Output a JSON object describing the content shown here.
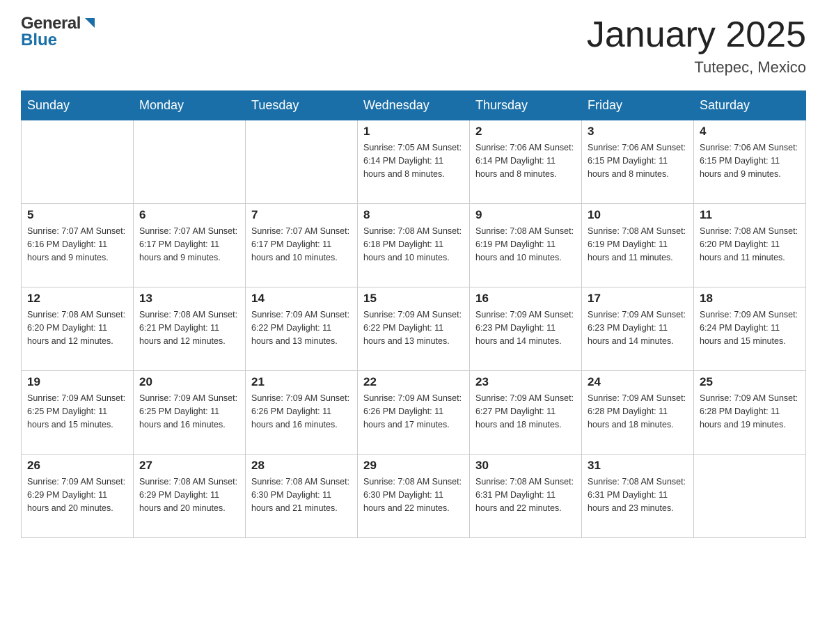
{
  "logo": {
    "text_general": "General",
    "text_blue": "Blue",
    "alt": "GeneralBlue logo"
  },
  "header": {
    "title": "January 2025",
    "subtitle": "Tutepec, Mexico"
  },
  "days_of_week": [
    "Sunday",
    "Monday",
    "Tuesday",
    "Wednesday",
    "Thursday",
    "Friday",
    "Saturday"
  ],
  "weeks": [
    [
      {
        "day": "",
        "info": ""
      },
      {
        "day": "",
        "info": ""
      },
      {
        "day": "",
        "info": ""
      },
      {
        "day": "1",
        "info": "Sunrise: 7:05 AM\nSunset: 6:14 PM\nDaylight: 11 hours and 8 minutes."
      },
      {
        "day": "2",
        "info": "Sunrise: 7:06 AM\nSunset: 6:14 PM\nDaylight: 11 hours and 8 minutes."
      },
      {
        "day": "3",
        "info": "Sunrise: 7:06 AM\nSunset: 6:15 PM\nDaylight: 11 hours and 8 minutes."
      },
      {
        "day": "4",
        "info": "Sunrise: 7:06 AM\nSunset: 6:15 PM\nDaylight: 11 hours and 9 minutes."
      }
    ],
    [
      {
        "day": "5",
        "info": "Sunrise: 7:07 AM\nSunset: 6:16 PM\nDaylight: 11 hours and 9 minutes."
      },
      {
        "day": "6",
        "info": "Sunrise: 7:07 AM\nSunset: 6:17 PM\nDaylight: 11 hours and 9 minutes."
      },
      {
        "day": "7",
        "info": "Sunrise: 7:07 AM\nSunset: 6:17 PM\nDaylight: 11 hours and 10 minutes."
      },
      {
        "day": "8",
        "info": "Sunrise: 7:08 AM\nSunset: 6:18 PM\nDaylight: 11 hours and 10 minutes."
      },
      {
        "day": "9",
        "info": "Sunrise: 7:08 AM\nSunset: 6:19 PM\nDaylight: 11 hours and 10 minutes."
      },
      {
        "day": "10",
        "info": "Sunrise: 7:08 AM\nSunset: 6:19 PM\nDaylight: 11 hours and 11 minutes."
      },
      {
        "day": "11",
        "info": "Sunrise: 7:08 AM\nSunset: 6:20 PM\nDaylight: 11 hours and 11 minutes."
      }
    ],
    [
      {
        "day": "12",
        "info": "Sunrise: 7:08 AM\nSunset: 6:20 PM\nDaylight: 11 hours and 12 minutes."
      },
      {
        "day": "13",
        "info": "Sunrise: 7:08 AM\nSunset: 6:21 PM\nDaylight: 11 hours and 12 minutes."
      },
      {
        "day": "14",
        "info": "Sunrise: 7:09 AM\nSunset: 6:22 PM\nDaylight: 11 hours and 13 minutes."
      },
      {
        "day": "15",
        "info": "Sunrise: 7:09 AM\nSunset: 6:22 PM\nDaylight: 11 hours and 13 minutes."
      },
      {
        "day": "16",
        "info": "Sunrise: 7:09 AM\nSunset: 6:23 PM\nDaylight: 11 hours and 14 minutes."
      },
      {
        "day": "17",
        "info": "Sunrise: 7:09 AM\nSunset: 6:23 PM\nDaylight: 11 hours and 14 minutes."
      },
      {
        "day": "18",
        "info": "Sunrise: 7:09 AM\nSunset: 6:24 PM\nDaylight: 11 hours and 15 minutes."
      }
    ],
    [
      {
        "day": "19",
        "info": "Sunrise: 7:09 AM\nSunset: 6:25 PM\nDaylight: 11 hours and 15 minutes."
      },
      {
        "day": "20",
        "info": "Sunrise: 7:09 AM\nSunset: 6:25 PM\nDaylight: 11 hours and 16 minutes."
      },
      {
        "day": "21",
        "info": "Sunrise: 7:09 AM\nSunset: 6:26 PM\nDaylight: 11 hours and 16 minutes."
      },
      {
        "day": "22",
        "info": "Sunrise: 7:09 AM\nSunset: 6:26 PM\nDaylight: 11 hours and 17 minutes."
      },
      {
        "day": "23",
        "info": "Sunrise: 7:09 AM\nSunset: 6:27 PM\nDaylight: 11 hours and 18 minutes."
      },
      {
        "day": "24",
        "info": "Sunrise: 7:09 AM\nSunset: 6:28 PM\nDaylight: 11 hours and 18 minutes."
      },
      {
        "day": "25",
        "info": "Sunrise: 7:09 AM\nSunset: 6:28 PM\nDaylight: 11 hours and 19 minutes."
      }
    ],
    [
      {
        "day": "26",
        "info": "Sunrise: 7:09 AM\nSunset: 6:29 PM\nDaylight: 11 hours and 20 minutes."
      },
      {
        "day": "27",
        "info": "Sunrise: 7:08 AM\nSunset: 6:29 PM\nDaylight: 11 hours and 20 minutes."
      },
      {
        "day": "28",
        "info": "Sunrise: 7:08 AM\nSunset: 6:30 PM\nDaylight: 11 hours and 21 minutes."
      },
      {
        "day": "29",
        "info": "Sunrise: 7:08 AM\nSunset: 6:30 PM\nDaylight: 11 hours and 22 minutes."
      },
      {
        "day": "30",
        "info": "Sunrise: 7:08 AM\nSunset: 6:31 PM\nDaylight: 11 hours and 22 minutes."
      },
      {
        "day": "31",
        "info": "Sunrise: 7:08 AM\nSunset: 6:31 PM\nDaylight: 11 hours and 23 minutes."
      },
      {
        "day": "",
        "info": ""
      }
    ]
  ]
}
